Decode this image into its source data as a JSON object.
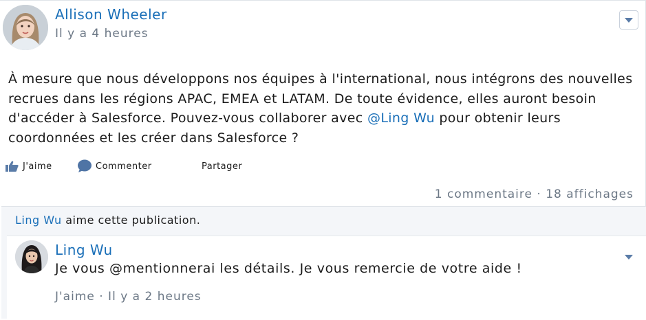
{
  "post": {
    "author": "Allison Wheeler",
    "time": "Il y a 4 heures",
    "body_before": "À mesure que nous développons nos équipes à l'international, nous intégrons des nouvelles recrues dans les régions APAC, EMEA et LATAM. De toute évidence, elles auront besoin d'accéder à Salesforce. Pouvez-vous collaborer avec ",
    "mention": "@Ling Wu",
    "body_after": " pour obtenir leurs coordonnées et les créer dans Salesforce ?",
    "actions": {
      "like": "J'aime",
      "comment": "Commenter",
      "share": "Partager"
    },
    "stats": "1 commentaire · 18 affichages"
  },
  "feed": {
    "likes_user": "Ling Wu",
    "likes_text": " aime cette publication.",
    "comment": {
      "author": "Ling Wu",
      "text": "Je vous @mentionnerai les détails. Je vous remercie de votre aide !",
      "meta": "J'aime · Il y a 2 heures"
    }
  },
  "colors": {
    "link": "#1a6fb8",
    "muted": "#6b7785",
    "feed_bg": "#f4f6f9",
    "icon": "#5a7ca8"
  },
  "icons": [
    "avatar-allison",
    "dropdown-triangle",
    "thumbs-up-icon",
    "comment-bubble-icon",
    "avatar-ling"
  ]
}
